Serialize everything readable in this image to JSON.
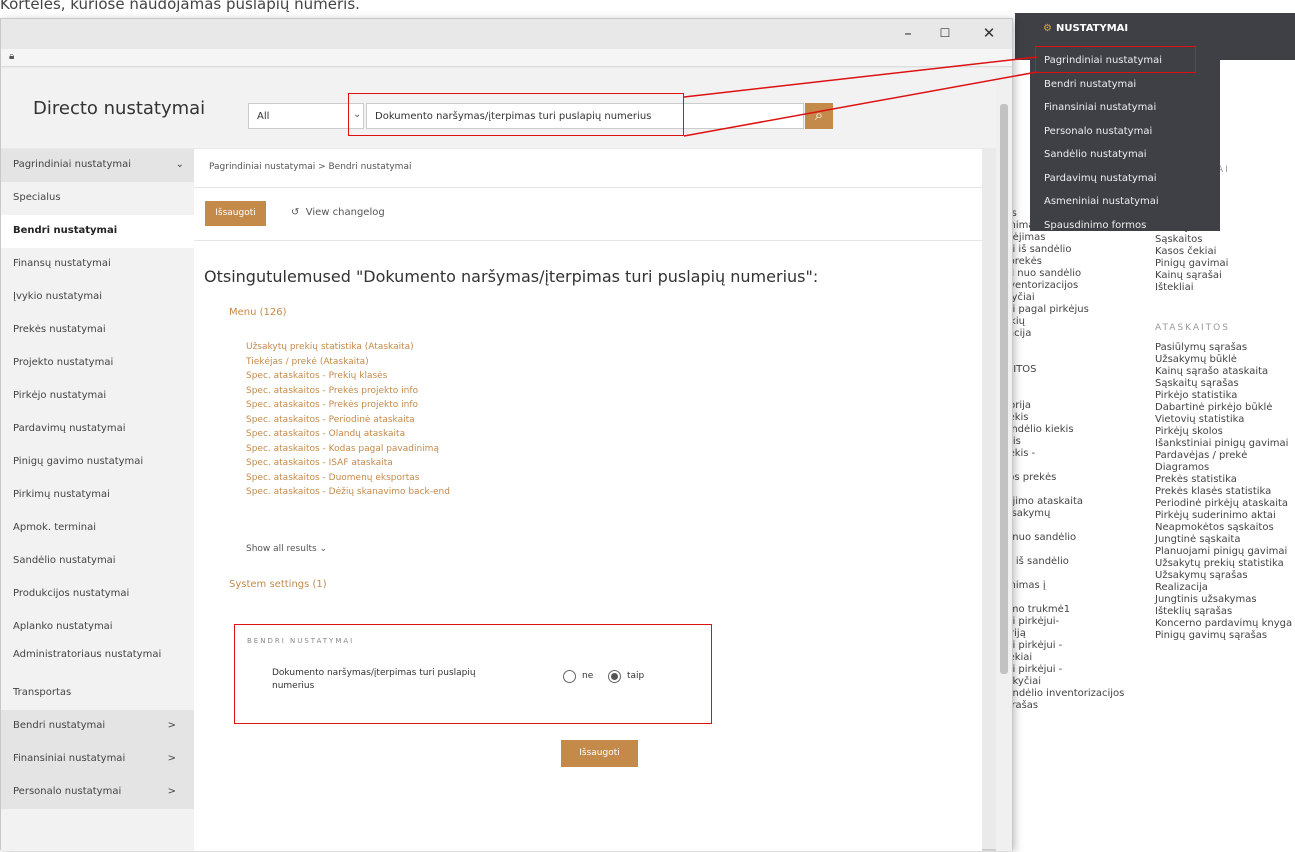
{
  "caption": "Korteles, kuriose naudojamas puslapių numeris.",
  "bg": {
    "topbar": {
      "title": "NUSTATYMAI"
    },
    "col1": [
      "užs",
      "ėmimai",
      "ndėjimas",
      "nai iš sandėlio",
      "s prekės",
      "sai nuo sandėlio",
      "inventorizacijos",
      "okyčiai",
      "nai pagal pirkėjus",
      "rekių",
      "izacija",
      "s",
      "",
      "KAITOS",
      "",
      "ja",
      "storija",
      "kiekis",
      "sandėlio kiekis",
      "eitis",
      "kiekis -",
      "es",
      "čios prekės",
      "os",
      "dėjimo ataskaita",
      "užsakymų",
      "",
      "ių nuo sandėlio",
      "",
      "nų iš sandėlio",
      "",
      "ėmimas į",
      "",
      "vimo trukmė1",
      "nai pirkėjui-",
      "toriją",
      "nai pirkėjui -",
      "kiekiai",
      "nai pirkėjui -",
      "pokyčiai",
      "Sandėlio inventorizacijos",
      "sarašas"
    ],
    "col2_head": "AI",
    "col2": [
      "Užsakymai",
      "Sąskaitos",
      "Kasos čekiai",
      "Pinigų gavimai",
      "Kainų sąrašai",
      "Ištekliai"
    ],
    "col2_reports_head": "ATASKAITOS",
    "col2_reports": [
      "Pasiūlymų sąrašas",
      "Užsakymų būklė",
      "Kainų sąrašo ataskaita",
      "Sąskaitų sąrašas",
      "Pirkėjo statistika",
      "Dabartinė pirkėjo būklė",
      "Vietovių statistika",
      "Pirkėjų skolos",
      "Išankstiniai pinigų gavimai",
      "Pardavėjas / prekė",
      "Diagramos",
      "Prekės statistika",
      "Prekės klasės statistika",
      "Periodinė pirkėjų ataskaita",
      "Pirkėjų suderinimo aktai",
      "Neapmokėtos sąskaitos",
      "Jungtinė sąskaita",
      "Planuojami pinigų gavimai",
      "Užsakytų prekių statistika",
      "Užsakymų sąrašas",
      "Realizacija",
      "Jungtinis užsakymas",
      "Išteklių sąrašas",
      "Koncerno pardavimų knyga",
      "Pinigų gavimų sąrašas"
    ]
  },
  "window": {
    "btn_minimize": "–",
    "btn_maximize": "☐",
    "btn_close": "✕",
    "app_title": "Directo nustatymai",
    "select_value": "All",
    "search_value": "Dokumento naršymas/įterpimas turi puslapių numerius"
  },
  "sidebar": {
    "items": [
      {
        "label": "Pagrindiniai nustatymai",
        "arrow": "⌄",
        "kind": "grp"
      },
      {
        "label": "Specialus",
        "kind": ""
      },
      {
        "label": "Bendri nustatymai",
        "kind": "act"
      },
      {
        "label": "Finansų nustatymai",
        "kind": ""
      },
      {
        "label": "Įvykio nustatymai",
        "kind": ""
      },
      {
        "label": "Prekės nustatymai",
        "kind": ""
      },
      {
        "label": "Projekto nustatymai",
        "kind": ""
      },
      {
        "label": "Pirkėjo nustatymai",
        "kind": ""
      },
      {
        "label": "Pardavimų nustatymai",
        "kind": ""
      },
      {
        "label": "Pinigų gavimo nustatymai",
        "kind": ""
      },
      {
        "label": "Pirkimų nustatymai",
        "kind": ""
      },
      {
        "label": "Apmok. terminai",
        "kind": ""
      },
      {
        "label": "Sandėlio nustatymai",
        "kind": ""
      },
      {
        "label": "Produkcijos nustatymai",
        "kind": ""
      },
      {
        "label": "Aplanko nustatymai",
        "kind": ""
      },
      {
        "label": "Administratoriaus nustatymai",
        "kind": "two"
      },
      {
        "label": "Transportas",
        "kind": ""
      },
      {
        "label": "Bendri nustatymai",
        "arrow": ">",
        "kind": "grp"
      },
      {
        "label": "Finansiniai nustatymai",
        "arrow": ">",
        "kind": "grp"
      },
      {
        "label": "Personalo nustatymai",
        "arrow": ">",
        "kind": "grp"
      }
    ]
  },
  "content": {
    "breadcrumb": "Pagrindiniai nustatymai > Bendri nustatymai",
    "save_label": "Išsaugoti",
    "changelog_icon": "↺",
    "changelog_label": "View changelog",
    "results_title": "Otsingutulemused \"Dokumento naršymas/įterpimas turi puslapių numerius\":",
    "menu_head": "Menu (126)",
    "results": [
      "Užsakytų prekių statistika (Ataskaita)",
      "Tiekėjas / prekė (Ataskaita)",
      "Spec. ataskaitos - Prekių klasės",
      "Spec. ataskaitos - Prekės projekto info",
      "Spec. ataskaitos - Prekės projekto info",
      "Spec. ataskaitos - Periodinė ataskaita",
      "Spec. ataskaitos - Olandų ataskaita",
      "Spec. ataskaitos - Kodas pagal pavadinimą",
      "Spec. ataskaitos - ISAF ataskaita",
      "Spec. ataskaitos - Duomenų eksportas",
      "Spec. ataskaitos - Dėžių skanavimo back-end"
    ],
    "show_all": "Show all results ⌄",
    "system_head": "System settings (1)",
    "setting_section": "BENDRI NUSTATYMAI",
    "setting_label": "Dokumento naršymas/įterpimas turi puslapių numerius",
    "opt_no": "ne",
    "opt_yes": "taip",
    "selected": "taip",
    "save_bottom": "Išsaugoti"
  },
  "dropdown": {
    "title": "NUSTATYMAI",
    "items": [
      "Pagrindiniai nustatymai",
      "Bendri nustatymai",
      "Finansiniai nustatymai",
      "Personalo nustatymai",
      "Sandėlio nustatymai",
      "Pardavimų nustatymai",
      "Asmeniniai nustatymai",
      "Spausdinimo formos"
    ]
  },
  "colors": {
    "accent": "#c48a4a",
    "highlight": "#dd1111",
    "dark": "#3e4046"
  }
}
